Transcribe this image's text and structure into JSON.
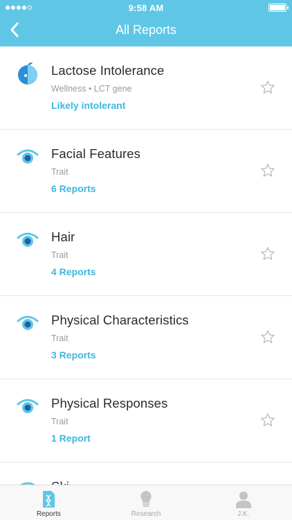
{
  "status_bar": {
    "time": "9:58 AM",
    "signal_bars_filled": 4,
    "signal_bars_total": 5
  },
  "nav": {
    "title": "All Reports",
    "back_icon": "chevron-left-icon"
  },
  "reports": [
    {
      "title": "Lactose Intolerance",
      "subtitle": "Wellness • LCT gene",
      "link": "Likely intolerant",
      "icon": "wellness-icon"
    },
    {
      "title": "Facial Features",
      "subtitle": "Trait",
      "link": "6 Reports",
      "icon": "eye-icon"
    },
    {
      "title": "Hair",
      "subtitle": "Trait",
      "link": "4 Reports",
      "icon": "eye-icon"
    },
    {
      "title": "Physical Characteristics",
      "subtitle": "Trait",
      "link": "3 Reports",
      "icon": "eye-icon"
    },
    {
      "title": "Physical Responses",
      "subtitle": "Trait",
      "link": "1 Report",
      "icon": "eye-icon"
    },
    {
      "title": "Ski",
      "subtitle": "",
      "link": "",
      "icon": "eye-icon"
    }
  ],
  "tabs": [
    {
      "label": "Reports",
      "icon": "dna-icon",
      "active": true
    },
    {
      "label": "Research",
      "icon": "lightbulb-icon",
      "active": false
    },
    {
      "label": "J.K.",
      "icon": "person-icon",
      "active": false
    }
  ],
  "colors": {
    "header": "#5fc6e6",
    "accent": "#3fb6de",
    "icon_blue": "#2b8fd6"
  }
}
